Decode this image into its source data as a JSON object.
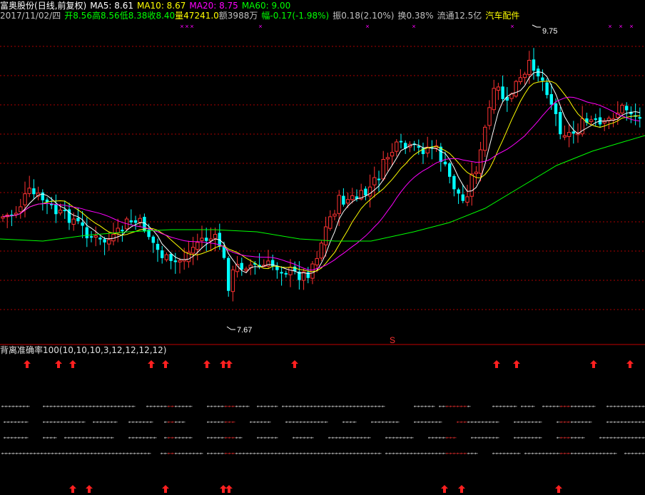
{
  "header": {
    "stock_name": "富奥股份",
    "view_mode": "(日线,前复权)",
    "ma5_label": "MA5: 8.61",
    "ma10_label": "MA10: 8.67",
    "ma20_label": "MA20: 8.75",
    "ma60_label": "MA60: 9.00",
    "date": "2017/11/02/四",
    "open_label": "开",
    "open": "8.56",
    "high_label": "高",
    "high": "8.56",
    "low_label": "低",
    "low": "8.38",
    "close_label": "收",
    "close": "8.40",
    "volume_label": "量",
    "volume": "47241.0",
    "amount": "额3988万",
    "change_label": "幅",
    "change": "-0.17(-1.98%)",
    "amplitude": "振0.18(2.10%)",
    "turnover": "换0.38%",
    "float_cap": "流通12.5亿",
    "industry": "汽车配件"
  },
  "chart": {
    "high_marker": "9.75",
    "low_marker": "7.67",
    "s_marker": "S"
  },
  "indicator": {
    "title": "背离准确率100(10,10,10,3,12,12,12,12)"
  },
  "colors": {
    "up": "#ff3232",
    "down": "#00ffff",
    "ma5": "#ffffff",
    "ma10": "#ffff00",
    "ma20": "#ff00ff",
    "ma60": "#00ff00",
    "grid": "#aa0000",
    "arrow": "#ff2020"
  },
  "chart_data": {
    "type": "candlestick",
    "price_range": [
      7.67,
      9.75
    ],
    "ma_last": {
      "MA5": 8.61,
      "MA10": 8.67,
      "MA20": 8.75,
      "MA60": 9.0
    }
  }
}
